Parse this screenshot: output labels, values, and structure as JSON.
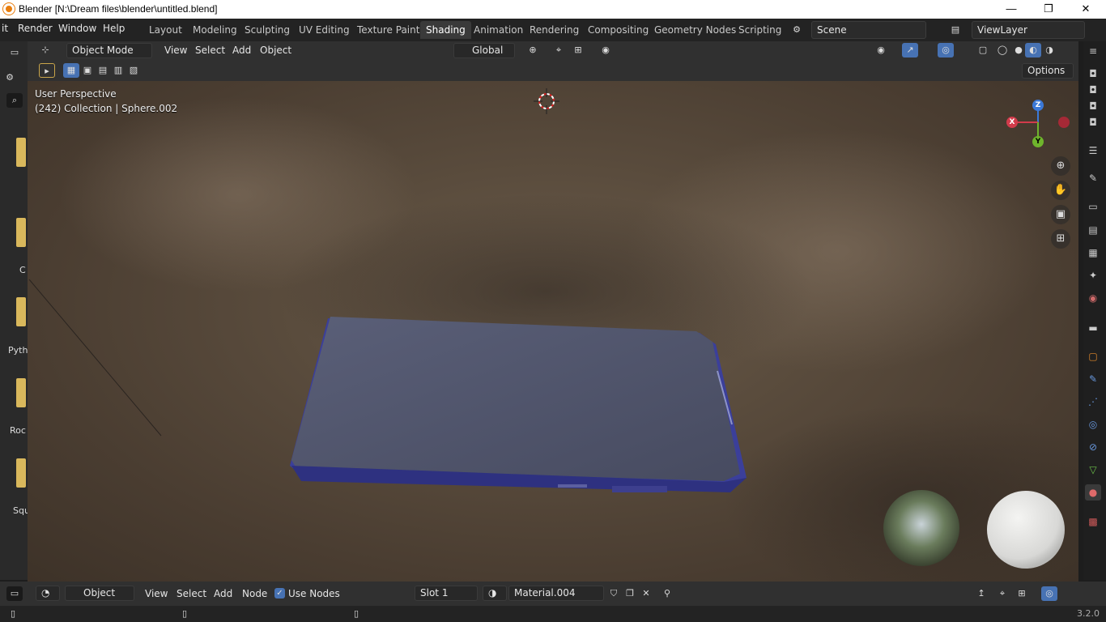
{
  "titlebar": {
    "title": "Blender [N:\\Dream files\\blender\\untitled.blend]",
    "minimize": "—",
    "restore": "❐",
    "close": "✕"
  },
  "menus": {
    "file_partial": "it",
    "render": "Render",
    "window": "Window",
    "help": "Help"
  },
  "workspaces": [
    "Layout",
    "Modeling",
    "Sculpting",
    "UV Editing",
    "Texture Paint",
    "Shading",
    "Animation",
    "Rendering",
    "Compositing",
    "Geometry Nodes",
    "Scripting"
  ],
  "active_workspace": "Shading",
  "scene": {
    "name": "Scene"
  },
  "view_layer": {
    "name": "ViewLayer"
  },
  "viewport_header": {
    "mode": "Object Mode",
    "view": "View",
    "select": "Select",
    "add": "Add",
    "object": "Object",
    "transform_orientation": "Global"
  },
  "viewport": {
    "options": "Options",
    "perspective_label": "User Perspective",
    "collection_label": "(242) Collection | Sphere.002"
  },
  "axes": {
    "x": "X",
    "y": "Y",
    "z": "Z"
  },
  "left_sidebar_labels": [
    "C",
    "Pyth",
    "Roc",
    "Squ"
  ],
  "node_header": {
    "editor_mode": "Object",
    "view": "View",
    "select": "Select",
    "add": "Add",
    "node": "Node",
    "use_nodes": "Use Nodes",
    "slot": "Slot 1",
    "material": "Material.004"
  },
  "statusbar": {
    "version": "3.2.0"
  },
  "colors": {
    "accent": "#4772b3",
    "active_tab": "#3a3a3a",
    "phone_body": "#4a4f6e"
  }
}
